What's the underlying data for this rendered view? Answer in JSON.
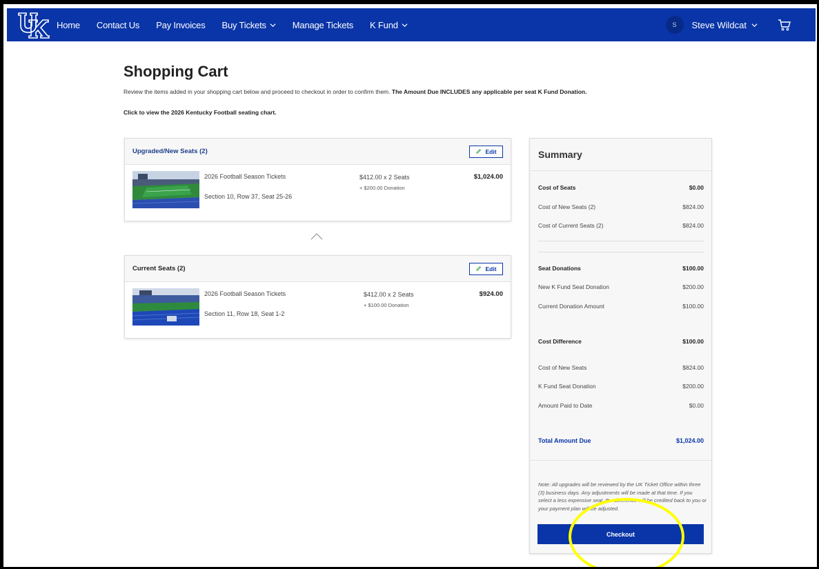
{
  "nav": {
    "logo_text": "UK",
    "links": [
      {
        "label": "Home",
        "has_dropdown": false
      },
      {
        "label": "Contact Us",
        "has_dropdown": false
      },
      {
        "label": "Pay Invoices",
        "has_dropdown": false
      },
      {
        "label": "Buy Tickets",
        "has_dropdown": true
      },
      {
        "label": "Manage Tickets",
        "has_dropdown": false
      },
      {
        "label": "K Fund",
        "has_dropdown": true
      }
    ],
    "avatar_initial": "S",
    "user_name": "Steve Wildcat",
    "cart_icon": "shopping-cart-icon",
    "bar_color": "#0a35a8"
  },
  "page": {
    "title": "Shopping Cart",
    "intro_text": "Review the items added in your shopping cart below and proceed to checkout in order to confirm them.",
    "intro_bold": "The Amount Due INCLUDES any applicable per seat K Fund Donation.",
    "chart_link": "Click to view the 2026 Kentucky Football seating chart."
  },
  "upgraded": {
    "title": "Upgraded/New Seats (2)",
    "edit_label": "Edit",
    "item_name": "2026 Football Season Tickets",
    "seat_info": "Section 10, Row 37, Seat 25-26",
    "price": "$412.00 x 2 Seats",
    "donation": "+ $200.00 Donation",
    "total": "$1,024.00"
  },
  "current": {
    "title": "Current Seats (2)",
    "edit_label": "Edit",
    "item_name": "2026 Football Season Tickets",
    "seat_info": "Section 11, Row 18, Seat 1-2",
    "price": "$412.00 x 2 Seats",
    "donation": "+ $100.00 Donation",
    "total": "$924.00"
  },
  "summary": {
    "title": "Summary",
    "cost_of_seats_label": "Cost of Seats",
    "cost_of_seats_value": "$0.00",
    "new_seats_label": "Cost of New Seats (2)",
    "new_seats_value": "$824.00",
    "current_seats_label": "Cost of Current Seats (2)",
    "current_seats_value": "$824.00",
    "seat_donations_label": "Seat Donations",
    "seat_donations_value": "$100.00",
    "new_donation_label": "New K Fund Seat Donation",
    "new_donation_value": "$200.00",
    "current_donation_label": "Current Donation Amount",
    "current_donation_value": "$100.00",
    "cost_diff_label": "Cost Difference",
    "cost_diff_value": "$100.00",
    "cost_new_label": "Cost of New Seats",
    "cost_new_value": "$824.00",
    "kfund_label": "K Fund Seat Donation",
    "kfund_value": "$200.00",
    "paid_label": "Amount Paid to Date",
    "paid_value": "$0.00",
    "total_label": "Total Amount Due",
    "total_value": "$1,024.00",
    "note": "Note: All upgrades will be reviewed by the UK Ticket Office within three (3) business days. Any adjustments will be made at that time. If you select a less expensive seat, the difference will be credited back to you or your payment plan will be adjusted.",
    "checkout_label": "Checkout"
  },
  "colors": {
    "brand_blue": "#0a35a8",
    "highlight": "#ffff00"
  }
}
